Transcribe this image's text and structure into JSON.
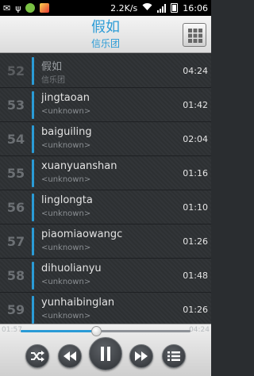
{
  "status_bar": {
    "speed": "2.2K/s",
    "time": "16:06"
  },
  "header": {
    "title": "假如",
    "subtitle": "信乐团",
    "grid_icon": "grid-icon"
  },
  "songs": [
    {
      "num": "52",
      "title": "假如",
      "artist": "信乐团",
      "duration": "04:24",
      "current": true
    },
    {
      "num": "53",
      "title": "jingtaoan",
      "artist": "<unknown>",
      "duration": "01:42"
    },
    {
      "num": "54",
      "title": "baiguiling",
      "artist": "<unknown>",
      "duration": "02:04"
    },
    {
      "num": "55",
      "title": "xuanyuanshan",
      "artist": "<unknown>",
      "duration": "01:16"
    },
    {
      "num": "56",
      "title": "linglongta",
      "artist": "<unknown>",
      "duration": "01:10"
    },
    {
      "num": "57",
      "title": "piaomiaowangc",
      "artist": "<unknown>",
      "duration": "01:26"
    },
    {
      "num": "58",
      "title": "dihuolianyu",
      "artist": "<unknown>",
      "duration": "01:48"
    },
    {
      "num": "59",
      "title": "yunhaibinglan",
      "artist": "<unknown>",
      "duration": "01:26"
    }
  ],
  "player": {
    "elapsed": "01:57",
    "total": "04:24",
    "progress_fraction": 0.443,
    "accent_color": "#2a9bd6"
  }
}
